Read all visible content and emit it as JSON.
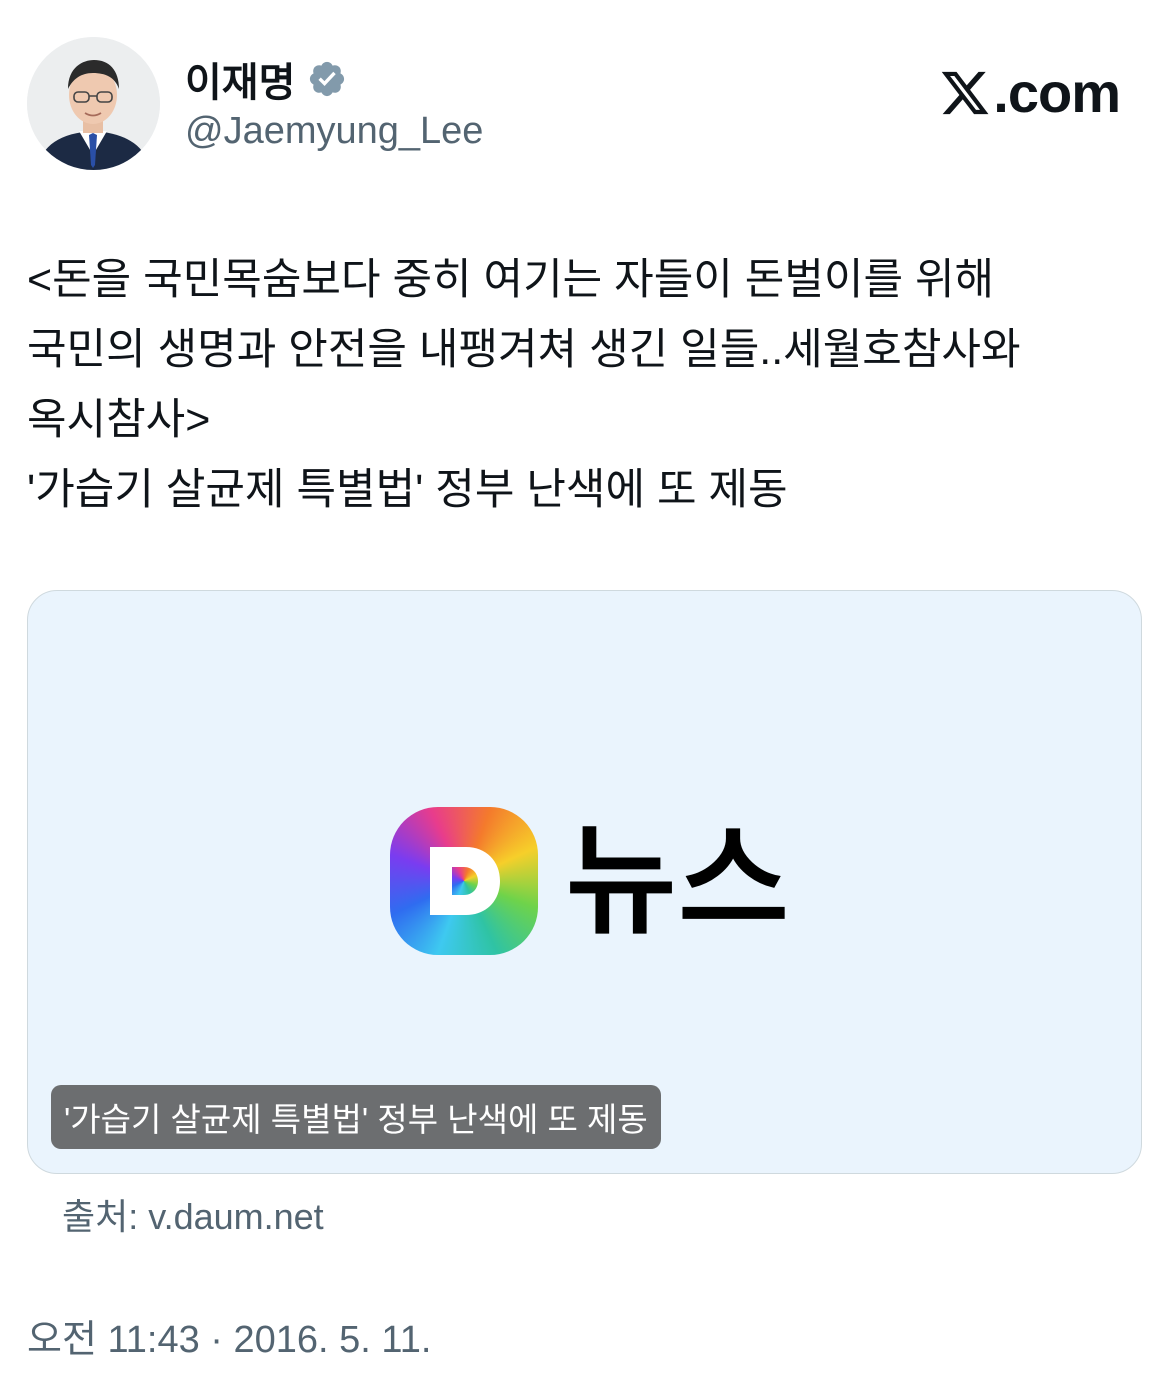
{
  "author": {
    "display_name": "이재명",
    "handle": "@Jaemyung_Lee",
    "verified_icon": "verified-badge-icon",
    "badge_color": "#829aab"
  },
  "site": {
    "logo_text": ".com",
    "logo_icon": "x-logo-icon"
  },
  "tweet": {
    "lines": [
      "<돈을 국민목숨보다 중히 여기는 자들이 돈벌이를 위해",
      "국민의 생명과 안전을 내팽겨쳐 생긴 일들..세월호참사와",
      "옥시참사>",
      "'가습기 살균제 특별법' 정부 난색에 또 제동"
    ]
  },
  "link_card": {
    "brand_icon": "daum-d-logo-icon",
    "brand_text": "뉴스",
    "caption": "'가습기 살균제 특별법' 정부 난색에 또 제동",
    "background": "#eaf4fd"
  },
  "source": {
    "text": "출처: v.daum.net"
  },
  "meta": {
    "timestamp": "오전 11:43 · 2016. 5. 11."
  }
}
